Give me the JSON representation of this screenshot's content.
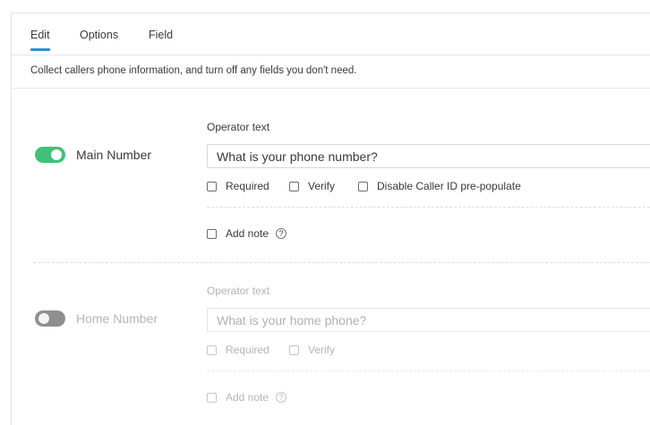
{
  "tabs": [
    {
      "label": "Edit",
      "active": true
    },
    {
      "label": "Options",
      "active": false
    },
    {
      "label": "Field",
      "active": false
    }
  ],
  "description": "Collect callers phone information, and turn off any fields you don't need.",
  "colors": {
    "accent": "#2a8fd0",
    "toggle_on": "#3fc17a",
    "toggle_off": "#8f8f8f"
  },
  "fields": [
    {
      "label": "Main Number",
      "enabled": true,
      "operator_label": "Operator text",
      "operator_value": "What is your phone number?",
      "checkboxes": [
        {
          "label": "Required",
          "checked": false
        },
        {
          "label": "Verify",
          "checked": false
        },
        {
          "label": "Disable Caller ID pre-populate",
          "checked": false
        }
      ],
      "add_note_label": "Add note",
      "help_icon": "question-circle-icon"
    },
    {
      "label": "Home Number",
      "enabled": false,
      "operator_label": "Operator text",
      "operator_placeholder": "What is your home phone?",
      "checkboxes": [
        {
          "label": "Required",
          "checked": false
        },
        {
          "label": "Verify",
          "checked": false
        }
      ],
      "add_note_label": "Add note",
      "help_icon": "question-circle-icon"
    }
  ]
}
